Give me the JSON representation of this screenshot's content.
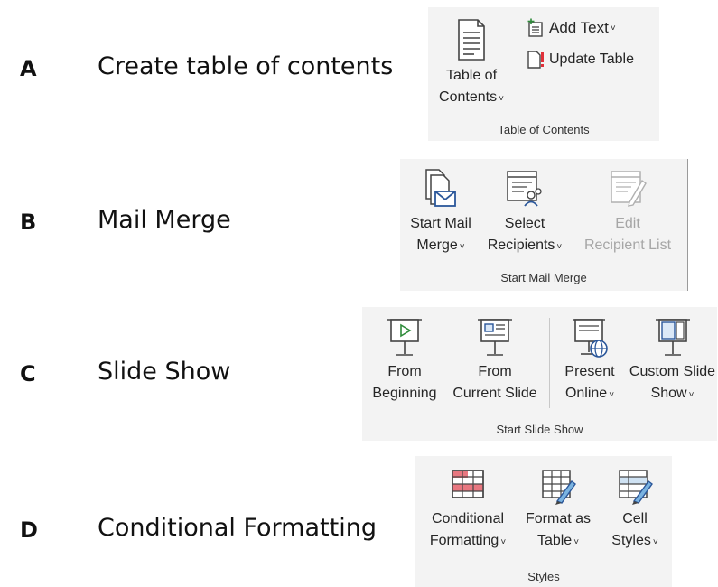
{
  "rows": [
    {
      "letter": "A",
      "label": "Create table of contents"
    },
    {
      "letter": "B",
      "label": "Mail Merge"
    },
    {
      "letter": "C",
      "label": "Slide Show"
    },
    {
      "letter": "D",
      "label": "Conditional Formatting"
    }
  ],
  "ribbon_a": {
    "group": "Table of Contents",
    "toc_line1": "Table of",
    "toc_line2": "Contents",
    "add_text": "Add Text",
    "update_table": "Update Table"
  },
  "ribbon_b": {
    "group": "Start Mail Merge",
    "start_line1": "Start Mail",
    "start_line2": "Merge",
    "select_line1": "Select",
    "select_line2": "Recipients",
    "edit_line1": "Edit",
    "edit_line2": "Recipient List"
  },
  "ribbon_c": {
    "group": "Start Slide Show",
    "from_beg_line1": "From",
    "from_beg_line2": "Beginning",
    "from_cur_line1": "From",
    "from_cur_line2": "Current Slide",
    "present_line1": "Present",
    "present_line2": "Online",
    "custom_line1": "Custom Slide",
    "custom_line2": "Show"
  },
  "ribbon_d": {
    "group": "Styles",
    "cond_line1": "Conditional",
    "cond_line2": "Formatting",
    "fmt_line1": "Format as",
    "fmt_line2": "Table",
    "cell_line1": "Cell",
    "cell_line2": "Styles"
  },
  "chevron": "˅",
  "colors": {
    "ribbon_bg": "#f3f3f3",
    "disabled": "#a6a6a6",
    "accent_blue": "#2b579a",
    "accent_red": "#e0303a"
  }
}
